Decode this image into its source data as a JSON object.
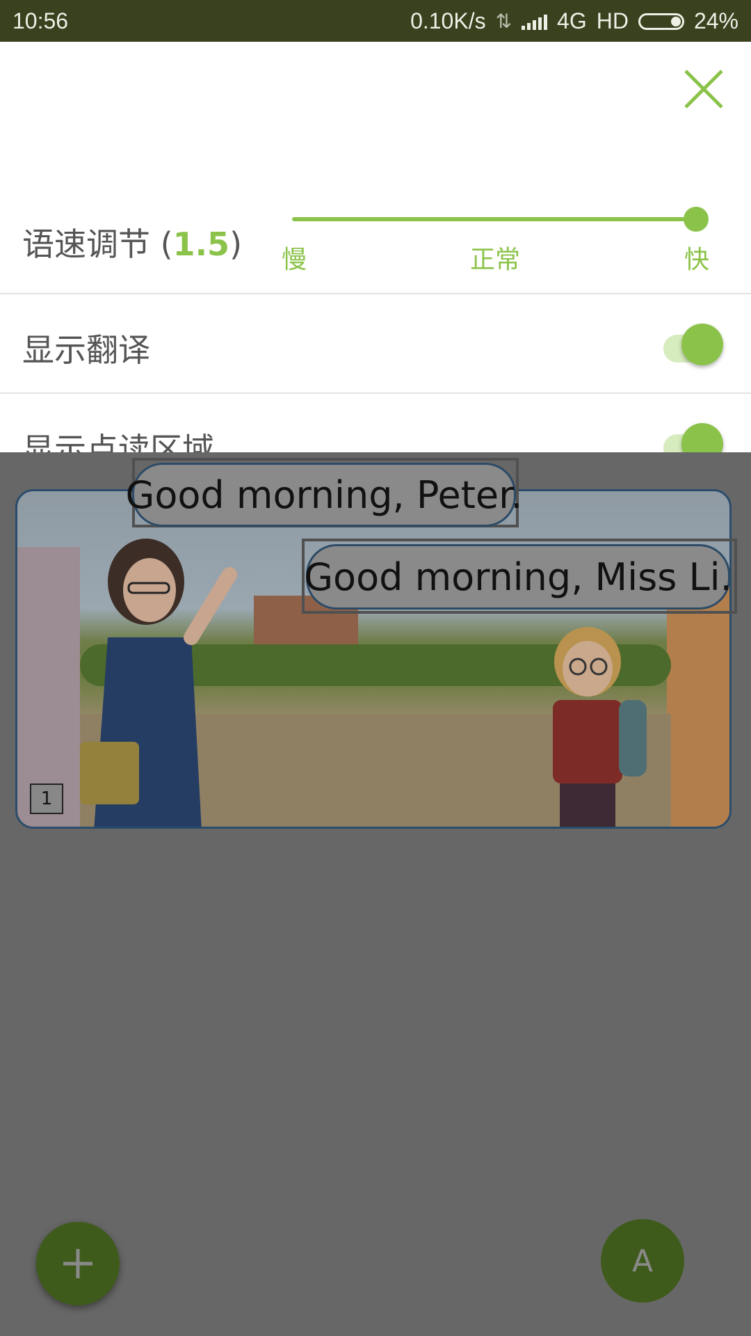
{
  "status_bar": {
    "time": "10:56",
    "net_speed": "0.10K/s",
    "network": "4G",
    "hd": "HD",
    "battery": "24%"
  },
  "settings": {
    "speed_label": "语速调节",
    "speed_value": "1.5",
    "speed_level": 1.5,
    "ticks": {
      "slow": "慢",
      "normal": "正常",
      "fast": "快"
    },
    "show_translation": {
      "label": "显示翻译",
      "enabled": true
    },
    "show_reading_area": {
      "label": "显示点读区域",
      "enabled": true
    }
  },
  "comic": {
    "panel_number": "1",
    "bubbles": [
      {
        "text": "Good morning, Peter."
      },
      {
        "text": "Good morning, Miss Li."
      }
    ]
  },
  "fab": {
    "add_icon": "plus-icon",
    "a_label": "A"
  },
  "colors": {
    "accent": "#8bc34a",
    "status_bar": "#39411f",
    "overlay": "#676767"
  }
}
